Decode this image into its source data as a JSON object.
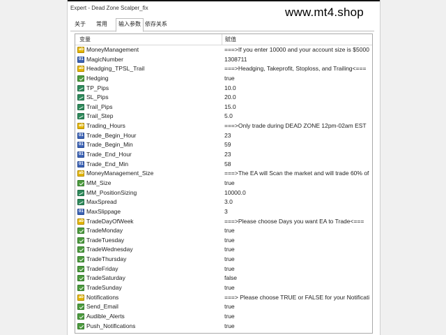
{
  "window": {
    "title": "Expert - Dead Zone Scalper_fix"
  },
  "watermark": "www.mt4.shop",
  "tabs": [
    {
      "label": "关于"
    },
    {
      "label": "常用"
    },
    {
      "label": "输入参数"
    },
    {
      "label": "依存关系"
    }
  ],
  "table": {
    "headers": {
      "name": "变量",
      "value": "赋值"
    },
    "rows": [
      {
        "icon": "ab",
        "name": "MoneyManagement",
        "value": "===>If you enter 10000 and your account size is $5000"
      },
      {
        "icon": "num",
        "name": "MagicNumber",
        "value": "1308711"
      },
      {
        "icon": "ab",
        "name": "Headging_TPSL_Trail",
        "value": "===>Headging, Takeprofit, Stoploss, and Trailing<==="
      },
      {
        "icon": "bool",
        "name": "Hedging",
        "value": "true"
      },
      {
        "icon": "dbl",
        "name": "TP_Pips",
        "value": "10.0"
      },
      {
        "icon": "dbl",
        "name": "SL_Pips",
        "value": "20.0"
      },
      {
        "icon": "dbl",
        "name": "Trail_Pips",
        "value": "15.0"
      },
      {
        "icon": "dbl",
        "name": "Trail_Step",
        "value": "5.0"
      },
      {
        "icon": "ab",
        "name": "Trading_Hours",
        "value": "===>Only trade during DEAD ZONE 12pm-02am EST"
      },
      {
        "icon": "num",
        "name": "Trade_Begin_Hour",
        "value": "23"
      },
      {
        "icon": "num",
        "name": "Trade_Begin_Min",
        "value": "59"
      },
      {
        "icon": "num",
        "name": "Trade_End_Hour",
        "value": "23"
      },
      {
        "icon": "num",
        "name": "Trade_End_Min",
        "value": "58"
      },
      {
        "icon": "ab",
        "name": "MoneyManagement_Size",
        "value": "===>The EA will Scan the market and will trade 60% of"
      },
      {
        "icon": "bool",
        "name": "MM_Size",
        "value": "true"
      },
      {
        "icon": "dbl",
        "name": "MM_PositionSizing",
        "value": "10000.0"
      },
      {
        "icon": "dbl",
        "name": "MaxSpread",
        "value": "3.0"
      },
      {
        "icon": "num",
        "name": "MaxSlippage",
        "value": "3"
      },
      {
        "icon": "ab",
        "name": "TradeDayOfWeek",
        "value": "===>Please choose Days you want EA to Trade<==="
      },
      {
        "icon": "bool",
        "name": "TradeMonday",
        "value": "true"
      },
      {
        "icon": "bool",
        "name": "TradeTuesday",
        "value": "true"
      },
      {
        "icon": "bool",
        "name": "TradeWednesday",
        "value": "true"
      },
      {
        "icon": "bool",
        "name": "TradeThursday",
        "value": "true"
      },
      {
        "icon": "bool",
        "name": "TradeFriday",
        "value": "true"
      },
      {
        "icon": "bool",
        "name": "TradeSaturday",
        "value": "false"
      },
      {
        "icon": "bool",
        "name": "TradeSunday",
        "value": "true"
      },
      {
        "icon": "ab",
        "name": "Notifications",
        "value": "===> Please choose TRUE or FALSE for your Notifications"
      },
      {
        "icon": "bool",
        "name": "Send_Email",
        "value": "true"
      },
      {
        "icon": "bool",
        "name": "Audible_Alerts",
        "value": "true"
      },
      {
        "icon": "bool",
        "name": "Push_Notifications",
        "value": "true"
      }
    ]
  }
}
